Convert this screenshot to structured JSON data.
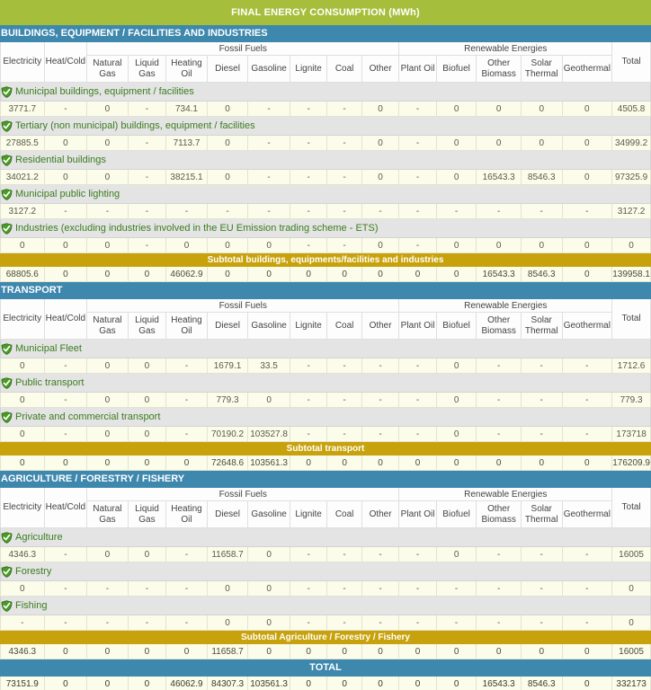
{
  "title": "FINAL ENERGY CONSUMPTION (MWh)",
  "colors": {
    "title_bar": "#a5bf3c",
    "section_bar": "#3e87ad",
    "subtotal_bar": "#c8a20c",
    "cell_bg": "#fbfce9",
    "category_bg": "#e4e4e4",
    "category_text": "#3b7d1e"
  },
  "column_groups": {
    "fossil_fuels": "Fossil Fuels",
    "renewable_energies": "Renewable Energies"
  },
  "columns": [
    "Electricity",
    "Heat/Cold",
    "Natural Gas",
    "Liquid Gas",
    "Heating Oil",
    "Diesel",
    "Gasoline",
    "Lignite",
    "Coal",
    "Other",
    "Plant Oil",
    "Biofuel",
    "Other Biomass",
    "Solar Thermal",
    "Geothermal",
    "Total"
  ],
  "icon": "shield-check-icon",
  "sections": [
    {
      "id": "buildings",
      "header": "BUILDINGS, EQUIPMENT / FACILITIES AND INDUSTRIES",
      "rows": [
        {
          "label": "Municipal buildings, equipment / facilities",
          "values": [
            "3771.7",
            "-",
            "0",
            "-",
            "734.1",
            "0",
            "-",
            "-",
            "-",
            "0",
            "-",
            "0",
            "0",
            "0",
            "0",
            "4505.8"
          ]
        },
        {
          "label": "Tertiary (non municipal) buildings, equipment / facilities",
          "values": [
            "27885.5",
            "0",
            "0",
            "-",
            "7113.7",
            "0",
            "-",
            "-",
            "-",
            "0",
            "-",
            "0",
            "0",
            "0",
            "0",
            "34999.2"
          ]
        },
        {
          "label": "Residential buildings",
          "values": [
            "34021.2",
            "0",
            "0",
            "-",
            "38215.1",
            "0",
            "-",
            "-",
            "-",
            "0",
            "-",
            "0",
            "16543.3",
            "8546.3",
            "0",
            "97325.9"
          ]
        },
        {
          "label": "Municipal public lighting",
          "values": [
            "3127.2",
            "-",
            "-",
            "-",
            "-",
            "-",
            "-",
            "-",
            "-",
            "-",
            "-",
            "-",
            "-",
            "-",
            "-",
            "3127.2"
          ]
        },
        {
          "label": "Industries (excluding industries involved in the EU Emission trading scheme - ETS)",
          "values": [
            "0",
            "0",
            "0",
            "-",
            "0",
            "0",
            "0",
            "-",
            "-",
            "0",
            "-",
            "0",
            "0",
            "0",
            "0",
            "0"
          ]
        }
      ],
      "subtotal": {
        "label": "Subtotal buildings, equipments/facilities and industries",
        "values": [
          "68805.6",
          "0",
          "0",
          "0",
          "46062.9",
          "0",
          "0",
          "0",
          "0",
          "0",
          "0",
          "0",
          "16543.3",
          "8546.3",
          "0",
          "139958.1"
        ]
      }
    },
    {
      "id": "transport",
      "header": "TRANSPORT",
      "rows": [
        {
          "label": "Municipal Fleet",
          "values": [
            "0",
            "-",
            "0",
            "0",
            "-",
            "1679.1",
            "33.5",
            "-",
            "-",
            "-",
            "-",
            "0",
            "-",
            "-",
            "-",
            "1712.6"
          ]
        },
        {
          "label": "Public transport",
          "values": [
            "0",
            "-",
            "0",
            "0",
            "-",
            "779.3",
            "0",
            "-",
            "-",
            "-",
            "-",
            "0",
            "-",
            "-",
            "-",
            "779.3"
          ]
        },
        {
          "label": "Private and commercial transport",
          "values": [
            "0",
            "-",
            "0",
            "0",
            "-",
            "70190.2",
            "103527.8",
            "-",
            "-",
            "-",
            "-",
            "0",
            "-",
            "-",
            "-",
            "173718"
          ]
        }
      ],
      "subtotal": {
        "label": "Subtotal transport",
        "values": [
          "0",
          "0",
          "0",
          "0",
          "0",
          "72648.6",
          "103561.3",
          "0",
          "0",
          "0",
          "0",
          "0",
          "0",
          "0",
          "0",
          "176209.9"
        ]
      }
    },
    {
      "id": "agriculture",
      "header": "AGRICULTURE / FORESTRY / FISHERY",
      "rows": [
        {
          "label": "Agriculture",
          "values": [
            "4346.3",
            "-",
            "0",
            "0",
            "-",
            "11658.7",
            "0",
            "-",
            "-",
            "-",
            "-",
            "0",
            "-",
            "-",
            "-",
            "16005"
          ]
        },
        {
          "label": "Forestry",
          "values": [
            "0",
            "-",
            "-",
            "-",
            "-",
            "0",
            "0",
            "-",
            "-",
            "-",
            "-",
            "-",
            "-",
            "-",
            "-",
            "0"
          ]
        },
        {
          "label": "Fishing",
          "values": [
            "-",
            "-",
            "-",
            "-",
            "-",
            "0",
            "0",
            "-",
            "-",
            "-",
            "-",
            "-",
            "-",
            "-",
            "-",
            "0"
          ]
        }
      ],
      "subtotal": {
        "label": "Subtotal Agriculture / Forestry / Fishery",
        "values": [
          "4346.3",
          "0",
          "0",
          "0",
          "0",
          "11658.7",
          "0",
          "0",
          "0",
          "0",
          "0",
          "0",
          "0",
          "0",
          "0",
          "16005"
        ]
      }
    }
  ],
  "grand_total": {
    "label": "TOTAL",
    "values": [
      "73151.9",
      "0",
      "0",
      "0",
      "46062.9",
      "84307.3",
      "103561.3",
      "0",
      "0",
      "0",
      "0",
      "0",
      "16543.3",
      "8546.3",
      "0",
      "332173"
    ]
  }
}
